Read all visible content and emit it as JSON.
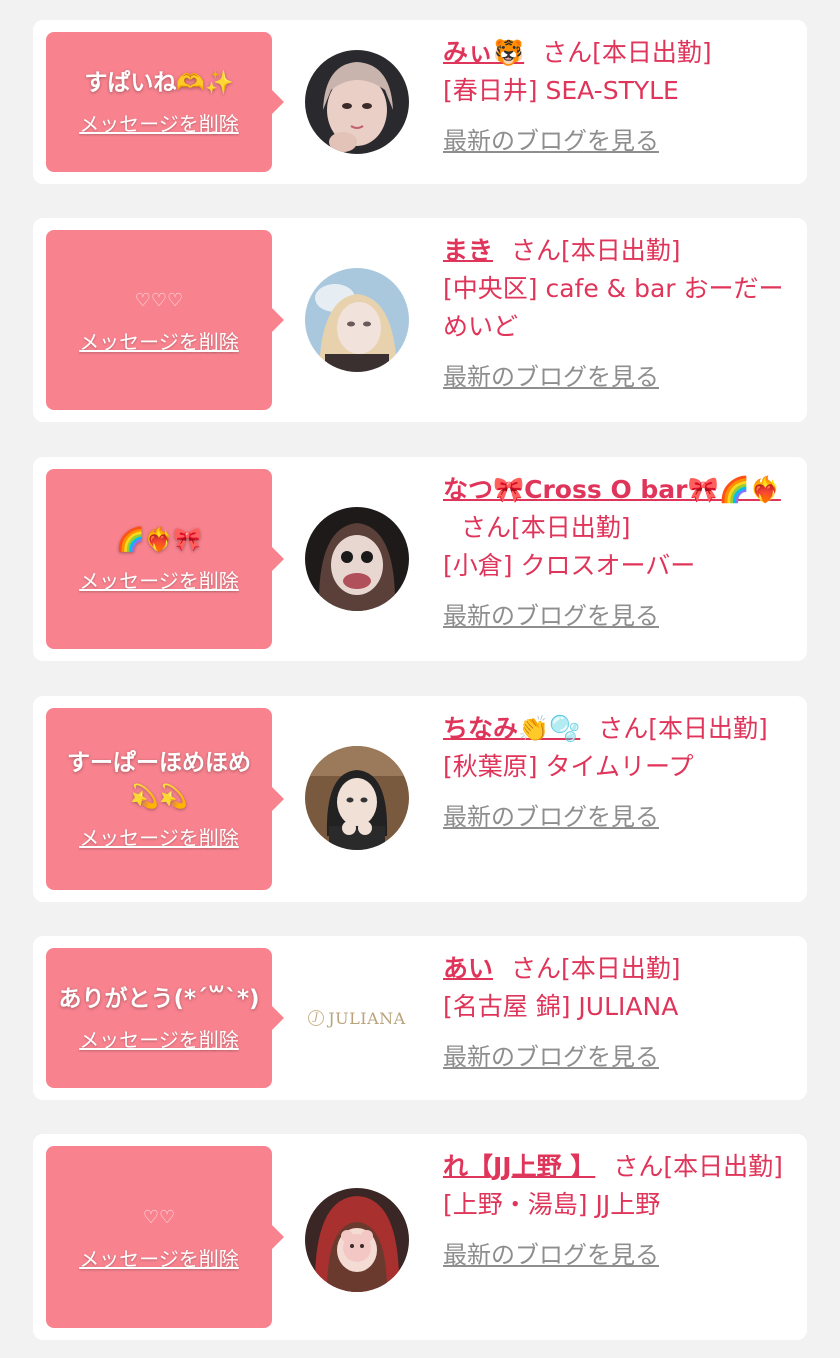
{
  "colors": {
    "bubble": "#f8838f",
    "accent": "#e0355a",
    "link_gray": "#8e8e8e",
    "background": "#f2f2f2"
  },
  "labels": {
    "delete": "メッセージを削除",
    "blog": "最新のブログを見る",
    "honorific": "さん"
  },
  "items": [
    {
      "message": "すぱいね🫶✨",
      "name": "みぃ🐯",
      "status": "[本日出勤]",
      "area": "[春日井]",
      "shop": "SEA-STYLE",
      "avatar": "photo"
    },
    {
      "message": "♡♡♡",
      "name": "まき",
      "status": "[本日出勤]",
      "area": "[中央区]",
      "shop": "cafe & bar おーだーめいど",
      "avatar": "photo"
    },
    {
      "message": "🌈❤️‍🔥🎀",
      "name": "なつ🎀Cross O bar🎀🌈❤️‍🔥",
      "status": "[本日出勤]",
      "area": "[小倉]",
      "shop": "クロスオーバー",
      "avatar": "photo"
    },
    {
      "message": "すーぱーほめほめ💫💫",
      "name": "ちなみ👏🫧",
      "status": "[本日出勤]",
      "area": "[秋葉原]",
      "shop": "タイムリープ",
      "avatar": "photo"
    },
    {
      "message": "ありがとう(*´꒳`*)",
      "name": "あい",
      "status": "[本日出勤]",
      "area": "[名古屋 錦]",
      "shop": "JULIANA",
      "avatar": "logo",
      "logo_text": "JULIANA"
    },
    {
      "message": "♡♡",
      "name": "れ【JJ上野 】",
      "status": "[本日出勤]",
      "area": "[上野・湯島]",
      "shop": "JJ上野",
      "avatar": "photo"
    }
  ]
}
